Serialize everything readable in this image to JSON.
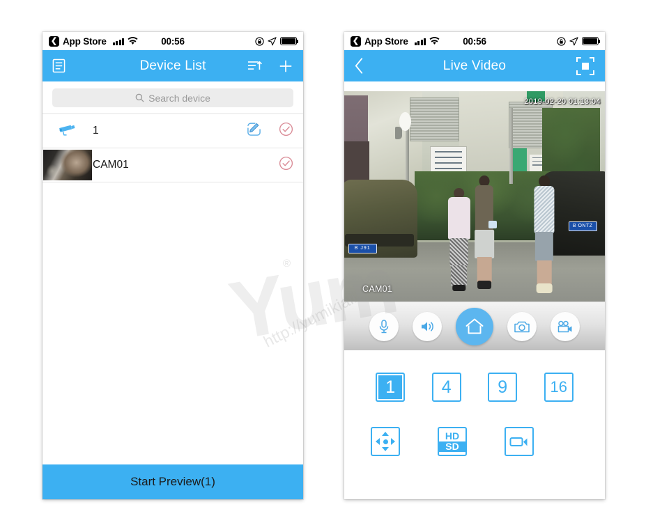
{
  "status_bar": {
    "back_app_label": "App Store",
    "time": "00:56",
    "icons": [
      "signal-bars-icon",
      "wifi-icon",
      "rotation-lock-icon",
      "location-arrow-icon",
      "battery-icon"
    ]
  },
  "watermark": {
    "brand": "Yum",
    "registered": "®",
    "url": "http://yumikiali"
  },
  "colors": {
    "accent_blue": "#3cb0f2",
    "home_button_blue": "#5cb6ef",
    "check_pink": "#d98a95",
    "search_bg": "#ececec"
  },
  "left_phone": {
    "nav": {
      "menu_icon": "list-menu-icon",
      "title": "Device List",
      "sort_icon": "sort-ascending-icon",
      "add_icon": "plus-icon"
    },
    "search": {
      "placeholder": "Search device",
      "icon": "search-icon"
    },
    "devices": [
      {
        "icon": "cctv-camera-icon",
        "name": "1",
        "has_edit": true,
        "edit_icon": "edit-pencil-icon",
        "select_icon": "check-circle-icon"
      },
      {
        "icon": "video-thumbnail",
        "name": "CAM01",
        "has_edit": false,
        "select_icon": "check-circle-icon"
      }
    ],
    "cta_label": "Start Preview(1)"
  },
  "right_phone": {
    "nav": {
      "back_icon": "chevron-left-icon",
      "title": "Live Video",
      "fullscreen_icon": "fullscreen-expand-icon"
    },
    "video": {
      "timestamp": "2019-02-20 01:13:04",
      "channel_label": "CAM01",
      "plate_left": "B  J91",
      "plate_right": "B ONTZ"
    },
    "controls": [
      {
        "name": "microphone-icon",
        "label": "Talk",
        "active": false
      },
      {
        "name": "speaker-icon",
        "label": "Listen",
        "active": false
      },
      {
        "name": "home-icon",
        "label": "Home",
        "active": true
      },
      {
        "name": "snapshot-camera-icon",
        "label": "Snapshot",
        "active": false
      },
      {
        "name": "video-recorder-icon",
        "label": "Record",
        "active": false
      }
    ],
    "split_buttons": [
      {
        "label": "1",
        "selected": true
      },
      {
        "label": "4",
        "selected": false
      },
      {
        "label": "9",
        "selected": false
      },
      {
        "label": "16",
        "selected": false
      }
    ],
    "tool_buttons": [
      {
        "name": "ptz-directional-icon",
        "label": ""
      },
      {
        "name": "quality-toggle-icon",
        "label_hd": "HD",
        "label_sd": "SD",
        "selected": "SD"
      },
      {
        "name": "record-video-icon",
        "label": ""
      }
    ]
  }
}
